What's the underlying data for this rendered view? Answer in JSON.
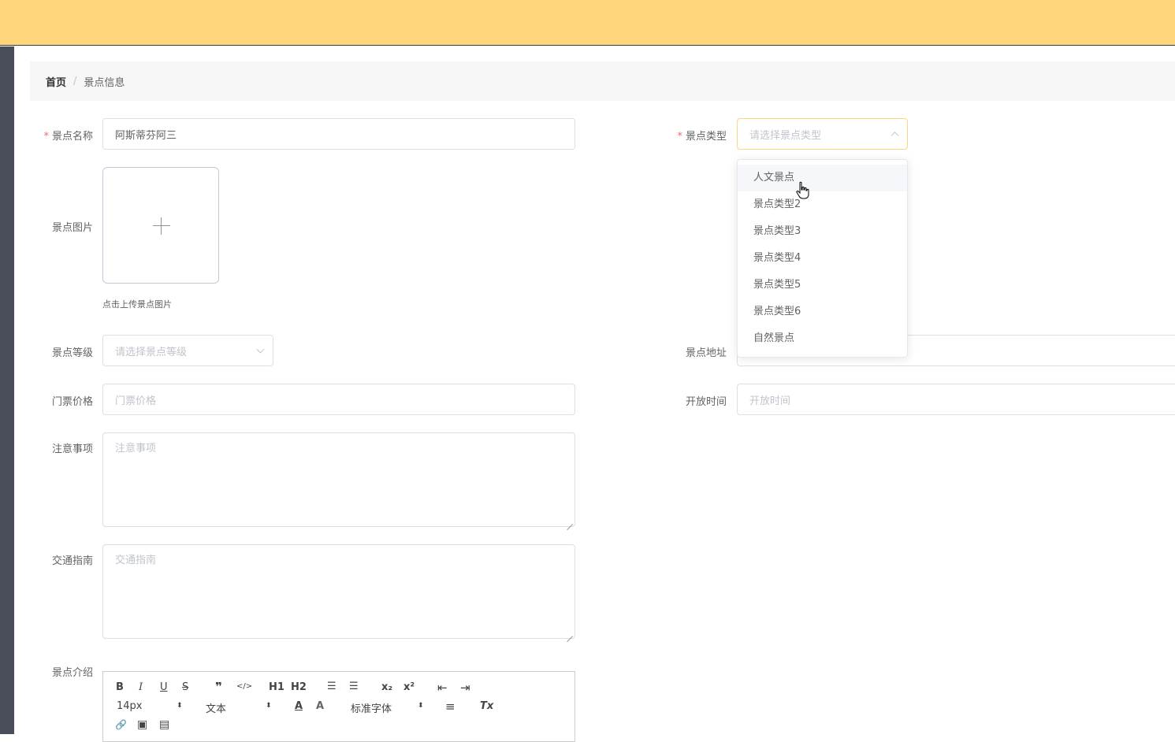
{
  "breadcrumb": {
    "home": "首页",
    "separator": "/",
    "current": "景点信息"
  },
  "form": {
    "name": {
      "label": "景点名称",
      "required_mark": "*",
      "value": "阿斯蒂芬阿三"
    },
    "type": {
      "label": "景点类型",
      "required_mark": "*",
      "placeholder": "请选择景点类型"
    },
    "image": {
      "label": "景点图片",
      "tip": "点击上传景点图片"
    },
    "level": {
      "label": "景点等级",
      "placeholder": "请选择景点等级"
    },
    "address": {
      "label": "景点地址"
    },
    "price": {
      "label": "门票价格",
      "placeholder": "门票价格"
    },
    "open_time": {
      "label": "开放时间",
      "placeholder": "开放时间"
    },
    "notes": {
      "label": "注意事项",
      "placeholder": "注意事项"
    },
    "traffic": {
      "label": "交通指南",
      "placeholder": "交通指南"
    },
    "intro": {
      "label": "景点介绍"
    }
  },
  "type_dropdown": {
    "options": [
      "人文景点",
      "景点类型2",
      "景点类型3",
      "景点类型4",
      "景点类型5",
      "景点类型6",
      "自然景点"
    ],
    "hovered_index": 0
  },
  "editor_toolbar": {
    "bold": "B",
    "italic": "I",
    "underline": "U",
    "strike": "S",
    "quote": "❞",
    "code": "</>",
    "h1": "H1",
    "h2": "H2",
    "ordered_list": "☰",
    "bullet_list": "☰",
    "sub": "x₂",
    "sup": "x²",
    "outdent": "⇤",
    "indent": "⇥",
    "size_value": "14px",
    "header_value": "文本",
    "font_value": "标准字体",
    "color": "A",
    "background": "A",
    "align": "≡",
    "clean": "Tx",
    "link": "🔗",
    "image": "▣",
    "video": "▤"
  },
  "colors": {
    "topbar": "#ffd67c",
    "sidebar": "#4a4d5a",
    "required": "#f56c6c"
  }
}
